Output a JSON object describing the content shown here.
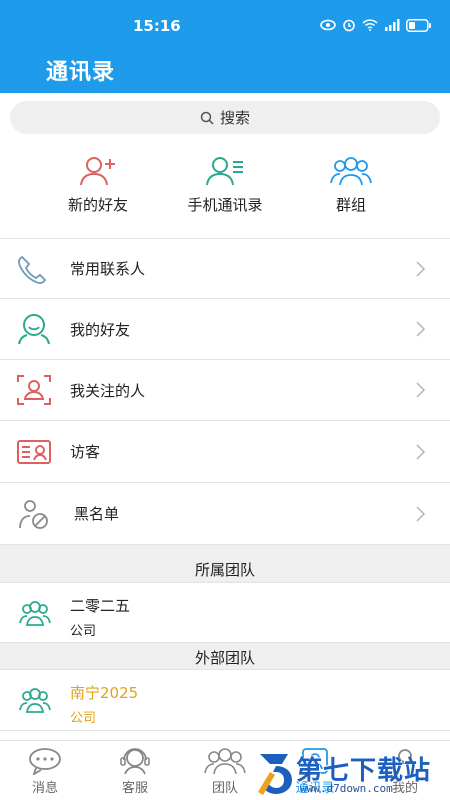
{
  "statusbar": {
    "time": "15:16"
  },
  "header": {
    "title": "通讯录"
  },
  "search": {
    "label": "搜索"
  },
  "quick": [
    {
      "label": "新的好友",
      "icon": "add-friend-icon"
    },
    {
      "label": "手机通讯录",
      "icon": "phone-contacts-icon"
    },
    {
      "label": "群组",
      "icon": "group-icon"
    }
  ],
  "menu": [
    {
      "label": "常用联系人",
      "icon": "phone-icon"
    },
    {
      "label": "我的好友",
      "icon": "friends-icon"
    },
    {
      "label": "我关注的人",
      "icon": "follow-icon"
    },
    {
      "label": "访客",
      "icon": "visitor-card-icon"
    },
    {
      "label": "黑名单",
      "icon": "blacklist-icon"
    }
  ],
  "sections": {
    "own_team": "所属团队",
    "external_team": "外部团队"
  },
  "teams": {
    "own": [
      {
        "name": "二零二五",
        "type": "公司"
      }
    ],
    "external": [
      {
        "name": "南宁2025",
        "type": "公司"
      }
    ]
  },
  "tabs": [
    {
      "label": "消息"
    },
    {
      "label": "客服"
    },
    {
      "label": "团队"
    },
    {
      "label": "通讯录"
    },
    {
      "label": "我的"
    }
  ],
  "watermark": {
    "brand": "第七下载站",
    "url": "www.d7down.com"
  },
  "colors": {
    "primary": "#1e9bea",
    "teal": "#2ba98f",
    "red": "#e06060",
    "gold": "#e2a21a"
  }
}
